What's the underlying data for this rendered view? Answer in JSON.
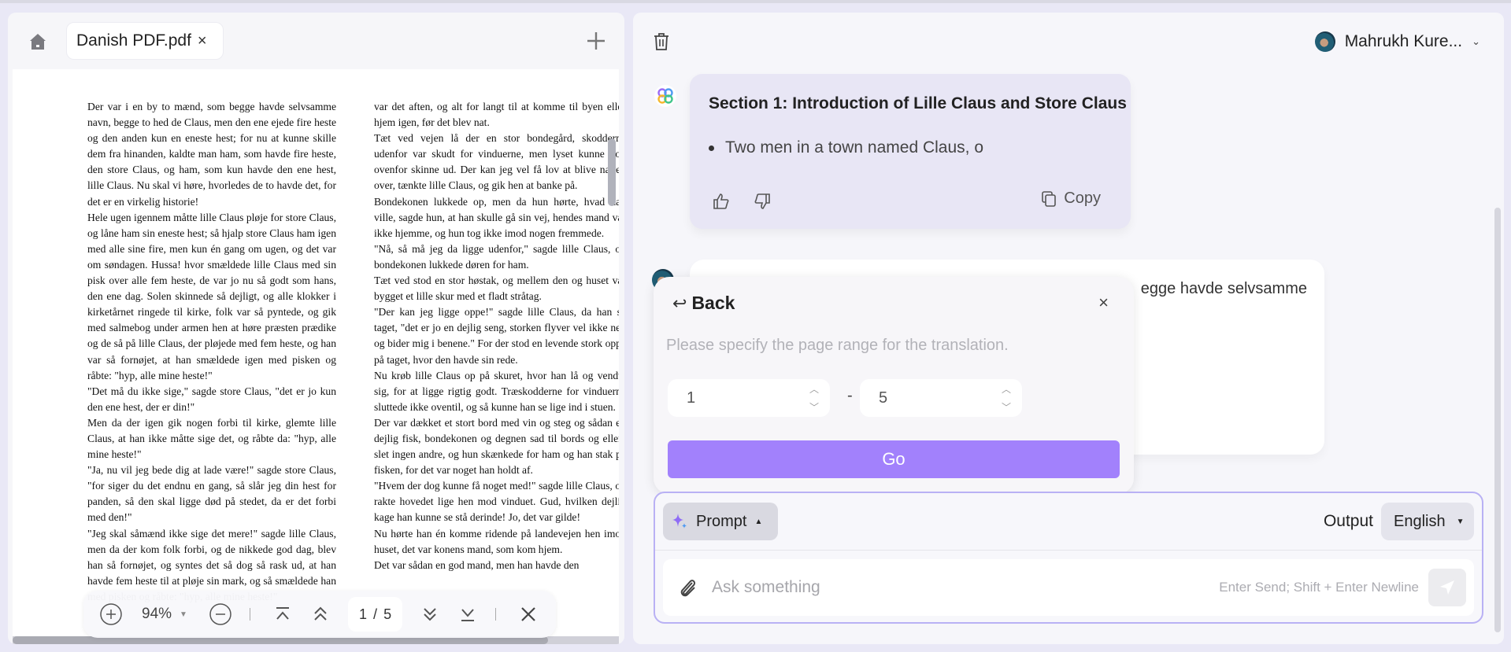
{
  "pdf_viewer": {
    "tab_name": "Danish PDF.pdf",
    "tab_close": "×",
    "zoom_level": "94%",
    "page_current": "1",
    "page_separator": "/",
    "page_total": "5",
    "column1": [
      "Der var i en by to mænd, som begge havde selvsamme navn, begge to hed de Claus, men den ene ejede fire heste og den anden kun en eneste hest; for nu at kunne skille dem fra hinanden, kaldte man ham, som havde fire heste, den store Claus, og ham, som kun havde den ene hest, lille Claus. Nu skal vi høre, hvorledes de to havde det, for det er en virkelig historie!",
      "Hele ugen igennem måtte lille Claus pløje for store Claus, og låne ham sin eneste hest; så hjalp store Claus ham igen med alle sine fire, men kun én gang om ugen, og det var om søndagen. Hussa! hvor smældede lille Claus med sin pisk over alle fem heste, de var jo nu så godt som hans, den ene dag. Solen skinnede så dejligt, og alle klokker i kirketårnet ringede til kirke, folk var så pyntede, og gik med salmebog under armen hen at høre præsten prædike og de så på lille Claus, der pløjede med fem heste, og han var så fornøjet, at han smældede igen med pisken og råbte: \"hyp, alle mine heste!\"",
      "\"Det må du ikke sige,\" sagde store Claus, \"det er jo kun den ene hest, der er din!\"",
      "Men da der igen gik nogen forbi til kirke, glemte lille Claus, at han ikke måtte sige det, og råbte da: \"hyp, alle mine heste!\"",
      "\"Ja, nu vil jeg bede dig at lade være!\" sagde store Claus, \"for siger du det endnu en gang, så slår jeg din hest for panden, så den skal ligge død på stedet, da er det forbi med den!\"",
      "\"Jeg skal såmænd ikke sige det mere!\" sagde lille Claus, men da der kom folk forbi, og de nikkede god dag, blev han så fornøjet, og syntes det så dog så rask ud, at han havde fem heste til at pløje sin mark, og så smældede han med pisken og råbte: \"hyp, alle mine heste!\""
    ],
    "column2": [
      "var det aften, og alt for langt til at komme til byen eller hjem igen, før det blev nat.",
      "Tæt ved vejen lå der en stor bondegård, skodderne udenfor var skudt for vinduerne, men lyset kunne dog ovenfor skinne ud. Der kan jeg vel få lov at blive natten over, tænkte lille Claus, og gik hen at banke på.",
      "Bondekonen lukkede op, men da hun hørte, hvad han ville, sagde hun, at han skulle gå sin vej, hendes mand var ikke hjemme, og hun tog ikke imod nogen fremmede.",
      "\"Nå, så må jeg da ligge udenfor,\" sagde lille Claus, og bondekonen lukkede døren for ham.",
      "Tæt ved stod en stor høstak, og mellem den og huset var bygget et lille skur med et fladt stråtag.",
      "\"Der kan jeg ligge oppe!\" sagde lille Claus, da han så taget, \"det er jo en dejlig seng, storken flyver vel ikke ned og bider mig i benene.\" For der stod en levende stork oppe på taget, hvor den havde sin rede.",
      "Nu krøb lille Claus op på skuret, hvor han lå og vendte sig, for at ligge rigtig godt. Træskodderne for vinduerne sluttede ikke oventil, og så kunne han se lige ind i stuen.",
      "Der var dækket et stort bord med vin og steg og sådan en dejlig fisk, bondekonen og degnen sad til bords og ellers slet ingen andre, og hun skænkede for ham og han stak på fisken, for det var noget han holdt af.",
      "\"Hvem der dog kunne få noget med!\" sagde lille Claus, og rakte hovedet lige hen mod vinduet. Gud, hvilken dejlig kage han kunne se stå derinde! Jo, det var gilde!",
      "Nu hørte han én komme ridende på landevejen hen imod huset, det var konens mand, som kom hjem.",
      "Det var sådan en god mand, men han havde den"
    ]
  },
  "chat": {
    "user_name": "Mahrukh Kure...",
    "ai_message": {
      "title": "Section 1: Introduction of Lille Claus and Store Claus",
      "bullet": "Two men in a town named Claus, o",
      "copy_label": "Copy"
    },
    "user_message_visible_text": "egge havde selvsamme"
  },
  "page_range_popover": {
    "back_label": "Back",
    "close": "×",
    "description": "Please specify the page range for the translation.",
    "from_value": "1",
    "to_value": "5",
    "separator": "-",
    "go_label": "Go"
  },
  "composer": {
    "prompt_label": "Prompt",
    "output_label": "Output",
    "language": "English",
    "input_placeholder": "Ask something",
    "hint": "Enter Send; Shift + Enter Newline"
  },
  "colors": {
    "accent": "#a281fc",
    "ai_card_bg": "#e8e6f5",
    "composer_border": "#b9b1f4"
  }
}
